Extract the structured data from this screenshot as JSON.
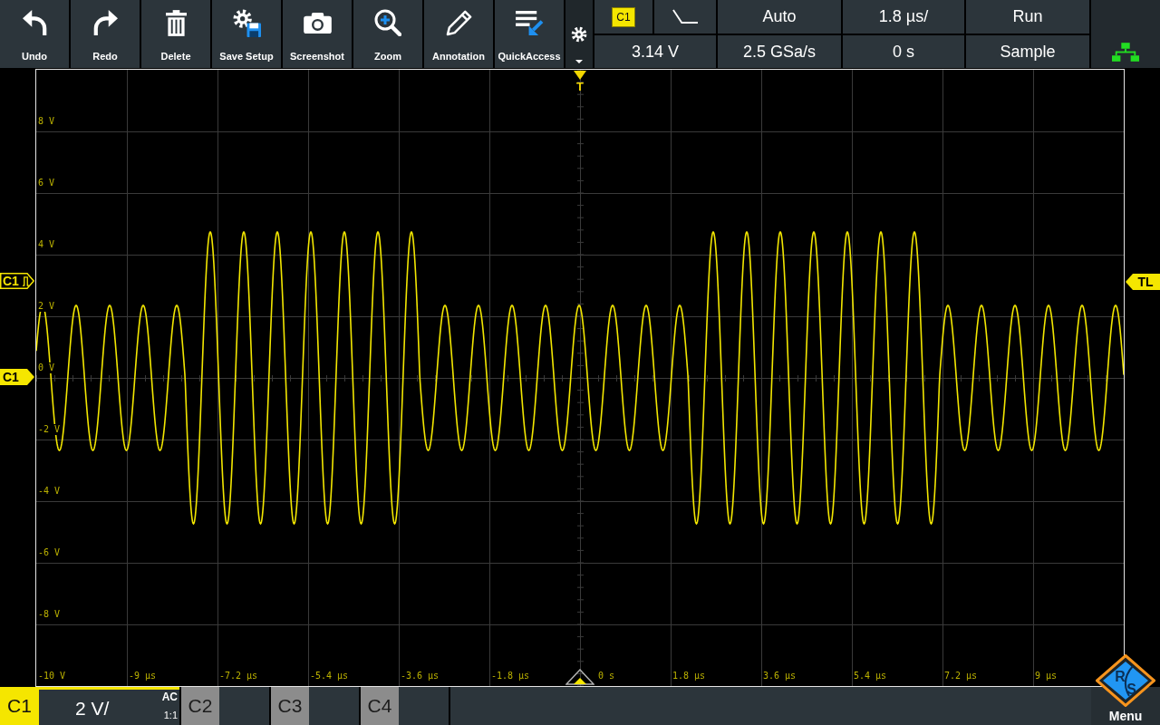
{
  "toolbar": {
    "buttons": [
      {
        "label": "Undo"
      },
      {
        "label": "Redo"
      },
      {
        "label": "Delete"
      },
      {
        "label": "Save Setup"
      },
      {
        "label": "Screenshot"
      },
      {
        "label": "Zoom"
      },
      {
        "label": "Annotation"
      },
      {
        "label": "QuickAccess"
      }
    ]
  },
  "status": {
    "trigger_source": "C1",
    "trigger_mode": "Auto",
    "time_scale": "1.8 µs/",
    "run_state": "Run",
    "trigger_level": "3.14 V",
    "sample_rate": "2.5 GSa/s",
    "time_position": "0 s",
    "acquisition_mode": "Sample"
  },
  "plot": {
    "trigger_marker": "T",
    "y_labels": [
      "8 V",
      "6 V",
      "4 V",
      "2 V",
      "0 V",
      "-2 V",
      "-4 V",
      "-6 V",
      "-8 V",
      "-10 V"
    ],
    "x_labels": [
      "-9 µs",
      "-7.2 µs",
      "-5.4 µs",
      "-3.6 µs",
      "-1.8 µs",
      "0 s",
      "1.8 µs",
      "3.6 µs",
      "5.4 µs",
      "7.2 µs",
      "9 µs"
    ]
  },
  "markers": {
    "left": [
      {
        "label": "C1",
        "kind": "trigger_level"
      },
      {
        "label": "C1",
        "kind": "channel_offset"
      }
    ],
    "right": [
      {
        "label": "TL"
      }
    ]
  },
  "channels": [
    {
      "label": "C1",
      "on": true,
      "scale": "2 V/",
      "coupling": "AC",
      "probe": "1:1"
    },
    {
      "label": "C2",
      "on": false
    },
    {
      "label": "C3",
      "on": false
    },
    {
      "label": "C4",
      "on": false
    }
  ],
  "menu": {
    "label": "Menu",
    "logo_letters": [
      "R",
      "S"
    ]
  }
}
